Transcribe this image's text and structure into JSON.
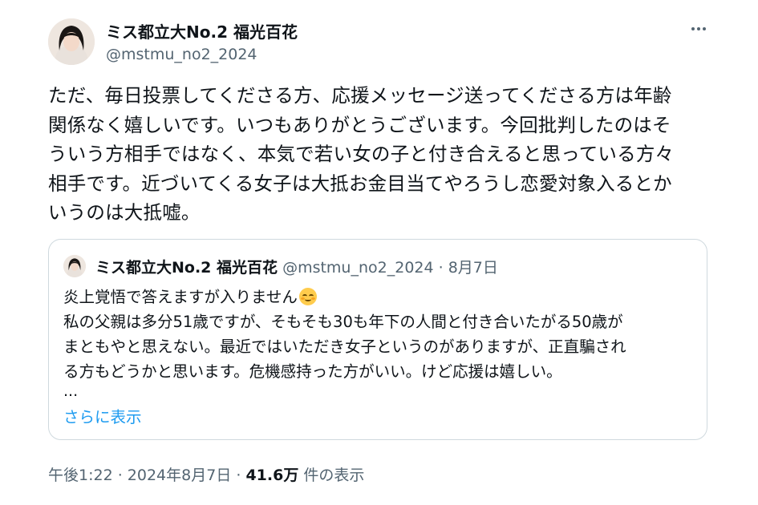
{
  "author": {
    "display_name": "ミス都立大No.2 福光百花",
    "handle": "@mstmu_no2_2024"
  },
  "icons": {
    "more": "more-horizontal-icon",
    "emoji": "smiling-face-with-blush-emoji"
  },
  "body_lines": [
    "ただ、毎日投票してくださる方、応援メッセージ送ってくださる方は年齢",
    "関係なく嬉しいです。いつもありがとうございます。今回批判したのはそ",
    "ういう方相手ではなく、本気で若い女の子と付き合えると思っている方々",
    "相手です。近づいてくる女子は大抵お金目当てやろうし恋愛対象入るとか",
    "いうのは大抵嘘。"
  ],
  "quoted": {
    "display_name": "ミス都立大No.2 福光百花",
    "handle": "@mstmu_no2_2024",
    "separator": " · ",
    "date": "8月7日",
    "lines": [
      "炎上覚悟で答えますが入りません",
      "私の父親は多分51歳ですが、そもそも30も年下の人間と付き合いたがる50歳が",
      "まともやと思えない。最近ではいただき女子というのがありますが、正直騙され",
      "る方もどうかと思います。危機感持った方がいい。けど応援は嬉しい。"
    ],
    "ellipsis": "...",
    "show_more": "さらに表示"
  },
  "footer": {
    "time": "午後1:22",
    "separator": " · ",
    "date": "2024年8月7日",
    "views_count": "41.6万",
    "views_label": " 件の表示"
  },
  "colors": {
    "text": "#0f1419",
    "secondary": "#536471",
    "link": "#1d9bf0",
    "border": "#cfd9de"
  }
}
